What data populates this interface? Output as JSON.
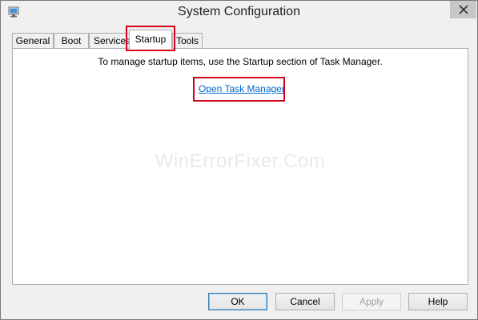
{
  "window": {
    "title": "System Configuration"
  },
  "tabs": [
    {
      "label": "General",
      "active": false
    },
    {
      "label": "Boot",
      "active": false
    },
    {
      "label": "Services",
      "active": false
    },
    {
      "label": "Startup",
      "active": true
    },
    {
      "label": "Tools",
      "active": false
    }
  ],
  "startup": {
    "info_text": "To manage startup items, use the Startup section of Task Manager.",
    "link_label": "Open Task Manager"
  },
  "watermark": "WinErrorFixer.Com",
  "buttons": {
    "ok": "OK",
    "cancel": "Cancel",
    "apply": "Apply",
    "help": "Help"
  },
  "colors": {
    "highlight": "#d0021b",
    "link": "#0066cc"
  },
  "icons": {
    "app": "msconfig-icon",
    "close": "close-icon"
  }
}
